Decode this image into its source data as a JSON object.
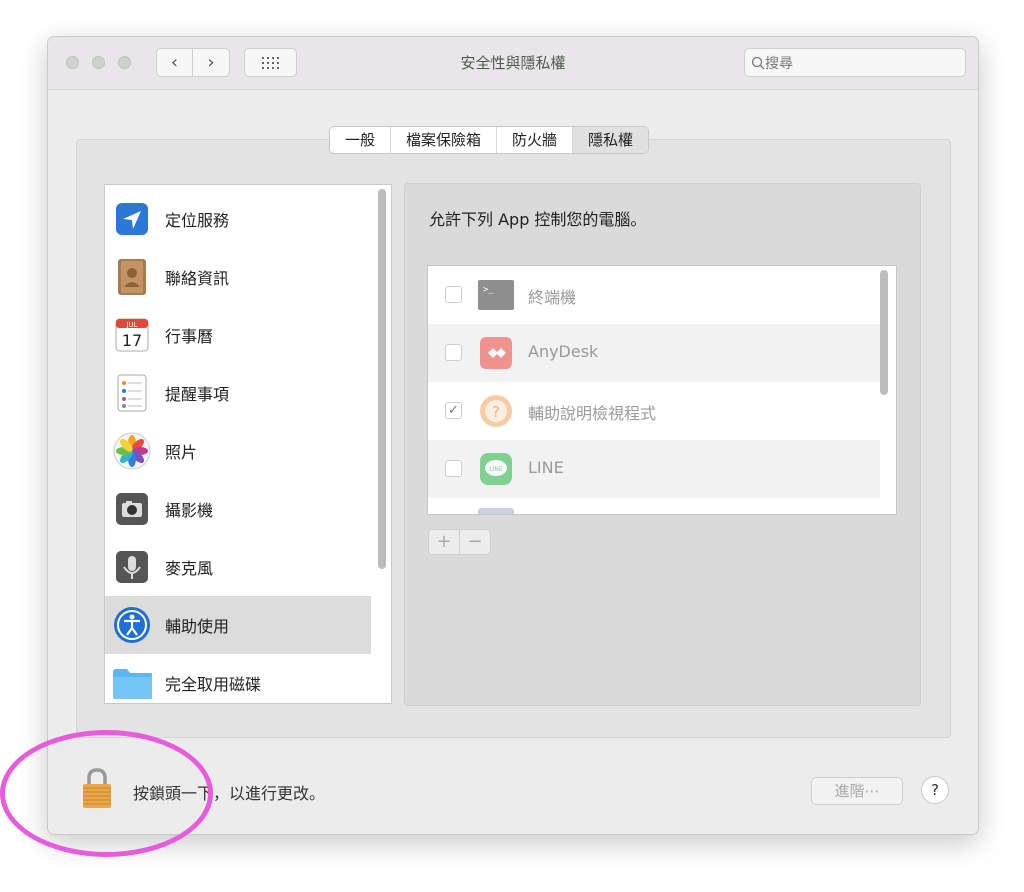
{
  "window": {
    "title": "安全性與隱私權",
    "search_placeholder": "搜尋",
    "nav_back": "‹",
    "nav_forward": "›",
    "grid_icon": "grid-icon"
  },
  "tabs": [
    {
      "label": "一般",
      "active": false
    },
    {
      "label": "檔案保險箱",
      "active": false
    },
    {
      "label": "防火牆",
      "active": false
    },
    {
      "label": "隱私權",
      "active": true
    }
  ],
  "privacy_list": {
    "selected": "輔助使用",
    "items": [
      {
        "label": "定位服務",
        "icon": "location-arrow-icon"
      },
      {
        "label": "聯絡資訊",
        "icon": "contacts-book-icon"
      },
      {
        "label": "行事曆",
        "icon": "calendar-icon",
        "icon_text": "17",
        "icon_month": "JUL"
      },
      {
        "label": "提醒事項",
        "icon": "reminders-list-icon"
      },
      {
        "label": "照片",
        "icon": "photos-flower-icon"
      },
      {
        "label": "攝影機",
        "icon": "camera-icon"
      },
      {
        "label": "麥克風",
        "icon": "microphone-icon"
      },
      {
        "label": "輔助使用",
        "icon": "accessibility-icon"
      },
      {
        "label": "完全取用磁碟",
        "icon": "folder-icon"
      }
    ]
  },
  "detail": {
    "heading": "允許下列 App 控制您的電腦。",
    "apps": [
      {
        "name": "終端機",
        "checked": false,
        "icon": "terminal-icon"
      },
      {
        "name": "AnyDesk",
        "checked": false,
        "icon": "anydesk-icon"
      },
      {
        "name": "輔助說明檢視程式",
        "checked": true,
        "icon": "help-viewer-icon"
      },
      {
        "name": "LINE",
        "checked": false,
        "icon": "line-app-icon"
      }
    ],
    "add_label": "+",
    "remove_label": "−"
  },
  "footer": {
    "lock_text": "按鎖頭一下，以進行更改。",
    "advanced_label": "進階⋯",
    "help_label": "?"
  },
  "colors": {
    "annotation_circle": "#e85bdc"
  }
}
